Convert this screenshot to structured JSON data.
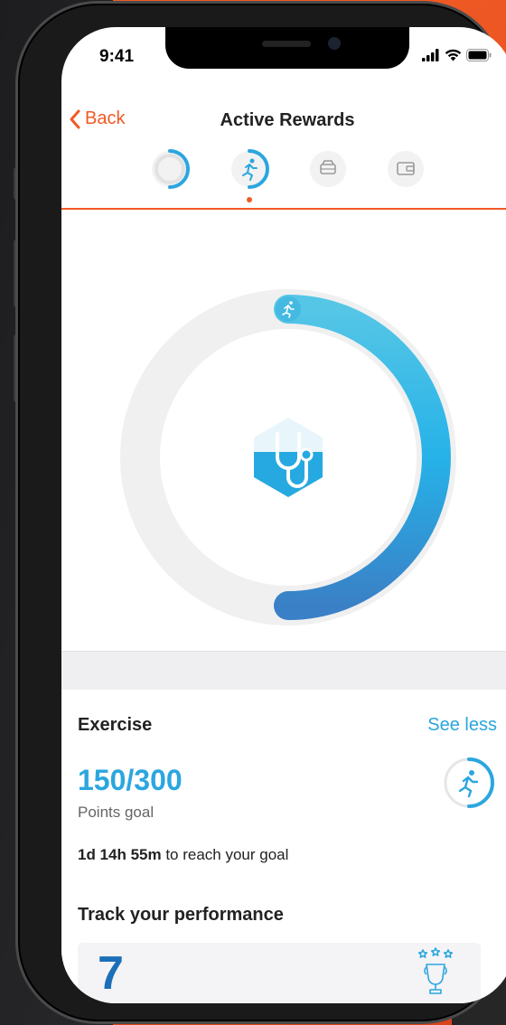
{
  "status_bar": {
    "time": "9:41"
  },
  "nav": {
    "back_label": "Back",
    "title": "Active Rewards"
  },
  "steps": [
    {
      "icon": "progress-ring-icon",
      "active": false
    },
    {
      "icon": "running-icon",
      "active": true
    },
    {
      "icon": "car-icon",
      "active": false
    },
    {
      "icon": "wallet-icon",
      "active": false
    }
  ],
  "hero": {
    "progress": 0.5,
    "center_icon": "stethoscope-icon",
    "marker_icon": "running-icon"
  },
  "exercise": {
    "title": "Exercise",
    "see_less_label": "See less",
    "points": "150/300",
    "points_label": "Points goal",
    "countdown_value": "1d 14h 55m",
    "countdown_suffix": " to reach your goal"
  },
  "performance": {
    "title": "Track your performance",
    "value": "7"
  },
  "colors": {
    "accent": "#f05a24",
    "blue": "#2ba6df",
    "blue_dark": "#1c6fb9"
  }
}
